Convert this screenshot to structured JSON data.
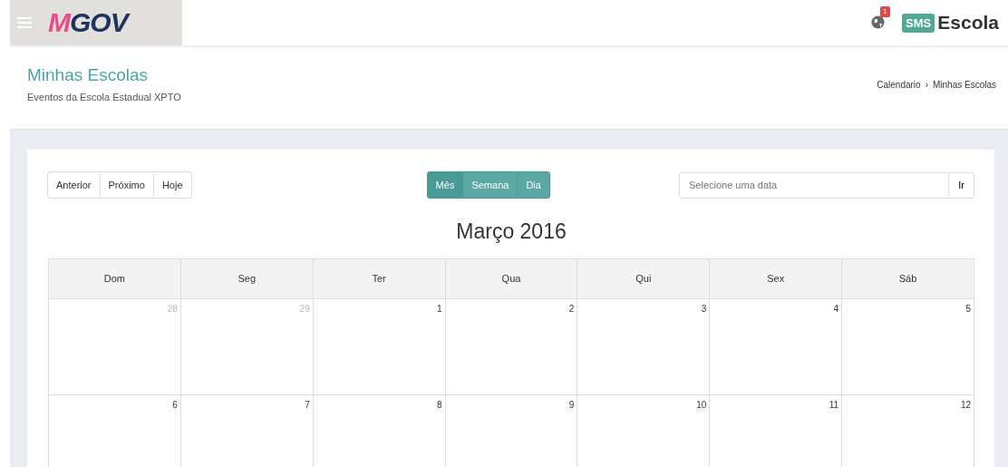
{
  "header": {
    "logo": "MGOV",
    "notification_count": "1",
    "brand_badge": "SMS",
    "brand_name": "Escola"
  },
  "page": {
    "title": "Minhas Escolas",
    "subtitle": "Eventos da Escola Estadual XPTO",
    "breadcrumb": [
      {
        "label": "Calendario"
      },
      {
        "label": "Minhas Escolas"
      }
    ],
    "breadcrumb_separator": "›"
  },
  "nav_buttons": [
    "Anterior",
    "Próximo",
    "Hoje"
  ],
  "view_buttons": [
    {
      "label": "Mês",
      "selected": true
    },
    {
      "label": "Semana",
      "selected": false
    },
    {
      "label": "Dia",
      "selected": false
    }
  ],
  "date_search": {
    "placeholder": "Selecione uma data",
    "button": "Ir"
  },
  "calendar": {
    "title": "Março 2016",
    "weekdays": [
      "Dom",
      "Seg",
      "Ter",
      "Qua",
      "Qui",
      "Sex",
      "Sáb"
    ],
    "weeks": [
      [
        {
          "day": "28",
          "other_month": true
        },
        {
          "day": "29",
          "other_month": true
        },
        {
          "day": "1",
          "other_month": false
        },
        {
          "day": "2",
          "other_month": false
        },
        {
          "day": "3",
          "other_month": false
        },
        {
          "day": "4",
          "other_month": false
        },
        {
          "day": "5",
          "other_month": false
        }
      ],
      [
        {
          "day": "6",
          "other_month": false
        },
        {
          "day": "7",
          "other_month": false
        },
        {
          "day": "8",
          "other_month": false
        },
        {
          "day": "9",
          "other_month": false
        },
        {
          "day": "10",
          "other_month": false
        },
        {
          "day": "11",
          "other_month": false
        },
        {
          "day": "12",
          "other_month": false
        }
      ]
    ]
  }
}
